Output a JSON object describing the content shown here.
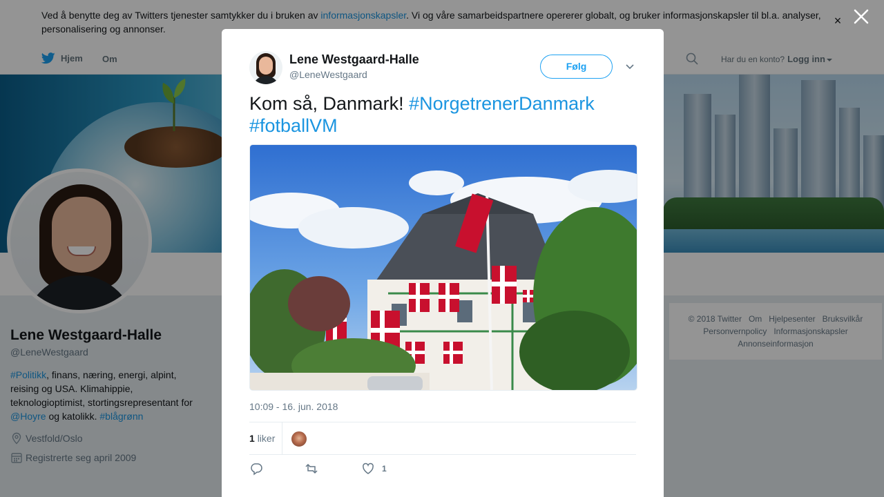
{
  "cookie_banner": {
    "text_before": "Ved å benytte deg av Twitters tjenester samtykker du i bruken av ",
    "link": "informasjonskapsler",
    "text_after": ". Vi og våre samarbeidspartnere opererer globalt, og bruker informasjonskapsler til bl.a. analyser, personalisering og annonser.",
    "close_icon": "×"
  },
  "nav": {
    "home": "Hjem",
    "about": "Om",
    "login_prompt": "Har du en konto?",
    "login": "Logg inn"
  },
  "profile": {
    "name": "Lene Westgaard-Halle",
    "handle": "@LeneWestgaard",
    "bio_parts": {
      "tag1": "#Politikk",
      "text1": ", finans, næring, energi, alpint, reising og USA. Klimahippie, teknologioptimist, stortingsrepresentant for ",
      "mention": "@Hoyre",
      "text2": " og katolikk. ",
      "tag2": "#blågrønn"
    },
    "location": "Vestfold/Oslo",
    "joined": "Registrerte seg april 2009"
  },
  "footer": {
    "copyright": "© 2018 Twitter",
    "links": [
      "Om",
      "Hjelpesenter",
      "Bruksvilkår",
      "Personvernpolicy",
      "Informasjonskapsler",
      "Annonseinformasjon"
    ]
  },
  "tweet": {
    "author_name": "Lene Westgaard-Halle",
    "author_handle": "@LeneWestgaard",
    "follow_label": "Følg",
    "text": "Kom så, Danmark! ",
    "hashtag1": "#NorgetrenerDanmark",
    "hashtag2": "#fotballVM",
    "timestamp": "10:09 - 16. jun. 2018",
    "likes_count": "1",
    "likes_label": "liker",
    "action_like_count": "1"
  },
  "icons": {
    "home": "twitter-bird-icon",
    "search": "search-icon",
    "location": "location-pin-icon",
    "calendar": "calendar-icon",
    "reply": "reply-icon",
    "retweet": "retweet-icon",
    "like": "heart-icon",
    "modal_close": "close-icon",
    "more": "chevron-down-icon"
  },
  "colors": {
    "link": "#1b95e0",
    "accent": "#1da1f2"
  }
}
